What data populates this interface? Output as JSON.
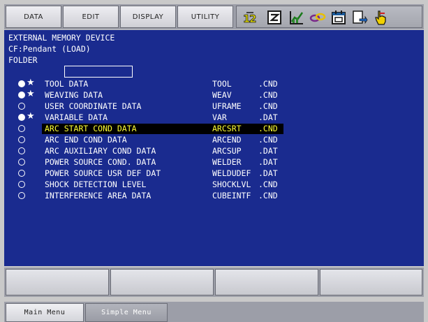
{
  "menu": {
    "tabs": [
      {
        "label": "DATA"
      },
      {
        "label": "EDIT"
      },
      {
        "label": "DISPLAY"
      },
      {
        "label": "UTILITY"
      }
    ]
  },
  "toolbar_icons": [
    "coordinate-toggle-icon",
    "edit-window-icon",
    "graph-icon",
    "link-icon",
    "calendar-icon",
    "window-switch-icon",
    "hand-pointer-icon"
  ],
  "header": {
    "title": "EXTERNAL MEMORY DEVICE",
    "device": "CF:Pendant (LOAD)",
    "folder_label": "FOLDER",
    "folder_value": ""
  },
  "items": [
    {
      "status": "saved",
      "label": "TOOL DATA",
      "file": "TOOL",
      "ext": ".CND"
    },
    {
      "status": "saved",
      "label": "WEAVING DATA",
      "file": "WEAV",
      "ext": ".CND"
    },
    {
      "status": "empty",
      "label": "USER COORDINATE DATA",
      "file": "UFRAME",
      "ext": ".CND"
    },
    {
      "status": "saved",
      "label": "VARIABLE DATA",
      "file": "VAR",
      "ext": ".DAT"
    },
    {
      "status": "empty",
      "label": "ARC START COND DATA",
      "file": "ARCSRT",
      "ext": ".CND",
      "selected": true
    },
    {
      "status": "empty",
      "label": "ARC END COND DATA",
      "file": "ARCEND",
      "ext": ".CND"
    },
    {
      "status": "empty",
      "label": "ARC AUXILIARY COND DATA",
      "file": "ARCSUP",
      "ext": ".DAT"
    },
    {
      "status": "empty",
      "label": "POWER SOURCE COND. DATA",
      "file": "WELDER",
      "ext": ".DAT"
    },
    {
      "status": "empty",
      "label": "POWER SOURCE USR DEF DAT",
      "file": "WELDUDEF",
      "ext": ".DAT"
    },
    {
      "status": "empty",
      "label": "SHOCK DETECTION LEVEL",
      "file": "SHOCKLVL",
      "ext": ".CND"
    },
    {
      "status": "empty",
      "label": "INTERFERENCE AREA DATA",
      "file": "CUBEINTF",
      "ext": ".CND"
    }
  ],
  "bottom_tabs": {
    "main_menu": "Main Menu",
    "simple_menu": "Simple Menu"
  },
  "colors": {
    "background": "#1a2b8f",
    "text": "#ffffff",
    "highlight_bg": "#000000",
    "highlight_text": "#ffff33"
  }
}
